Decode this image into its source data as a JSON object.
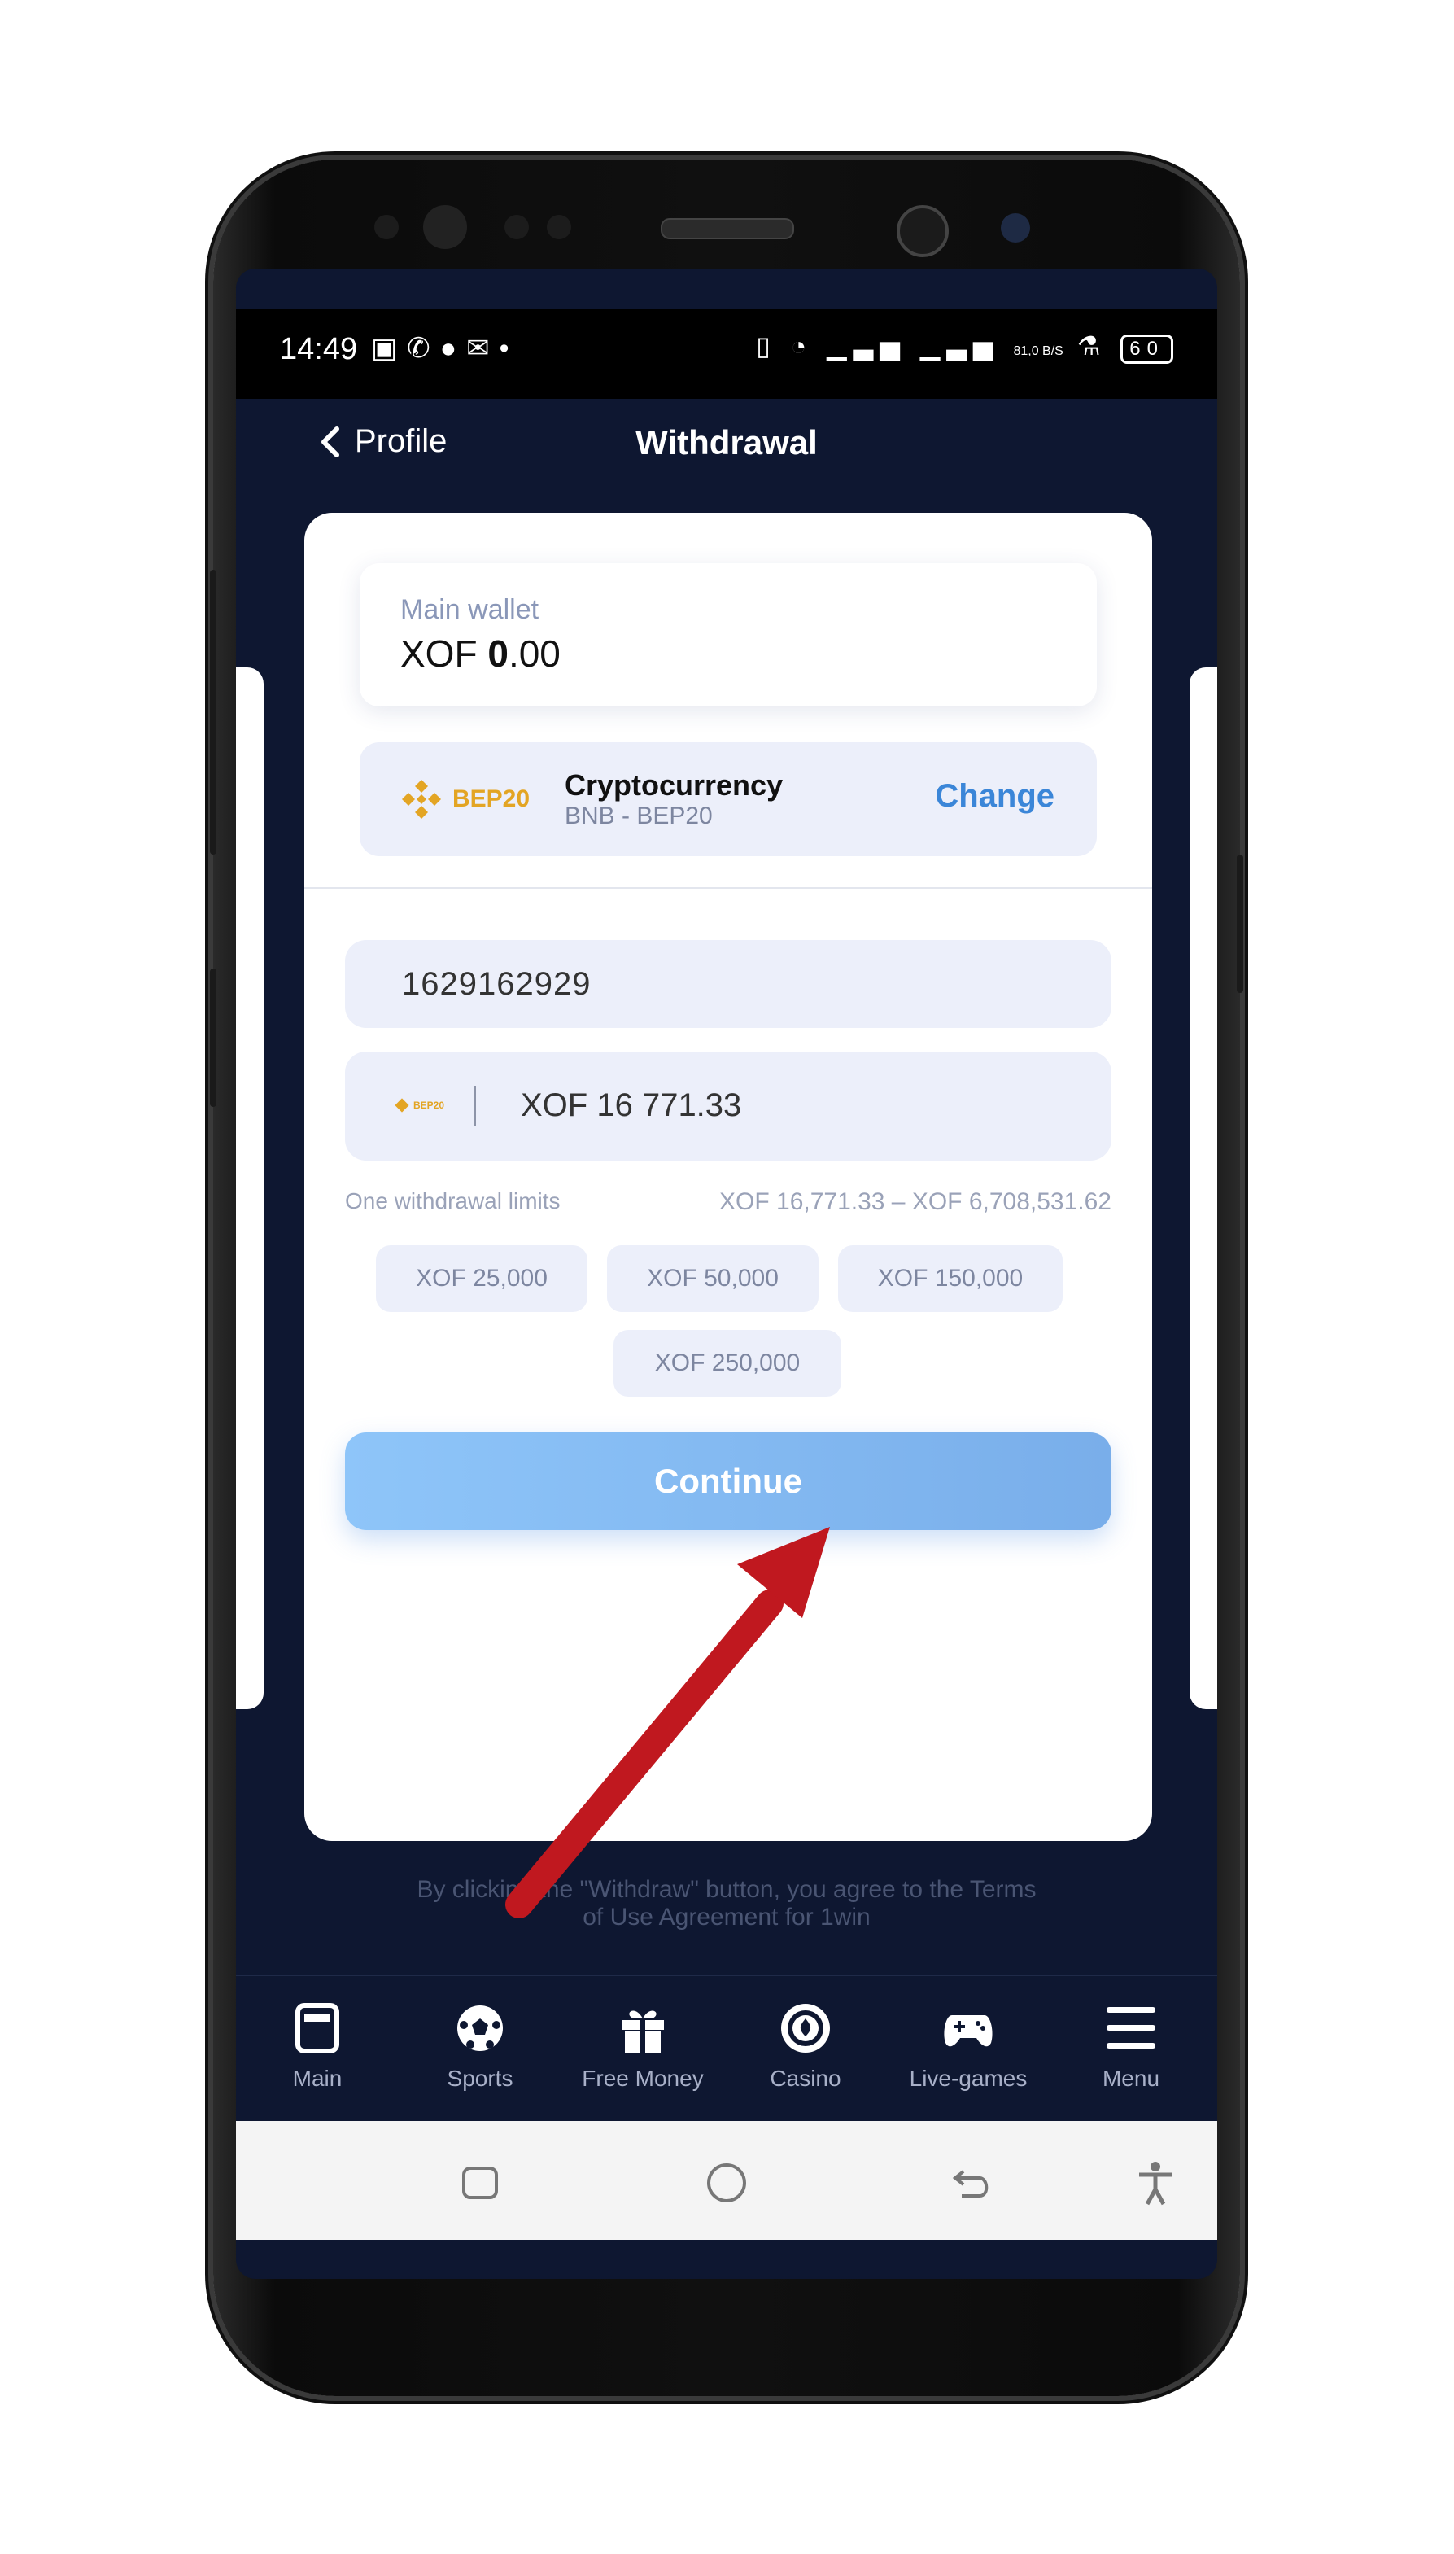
{
  "status_bar": {
    "time": "14:49",
    "battery": "60",
    "net_speed": "81,0 B/S"
  },
  "header": {
    "back_label": "Profile",
    "title": "Withdrawal"
  },
  "wallet": {
    "label": "Main wallet",
    "currency": "XOF",
    "amount_bold": "0",
    "amount_rest": ".00"
  },
  "method": {
    "logo_text": "BEP20",
    "name": "Cryptocurrency",
    "sub": "BNB - BEP20",
    "change_label": "Change"
  },
  "fields": {
    "account": "1629162929",
    "amount_logo": "BEP20",
    "amount": "XOF 16 771.33"
  },
  "limits": {
    "label": "One withdrawal limits",
    "range": "XOF 16,771.33  –  XOF 6,708,531.62"
  },
  "chips": [
    "XOF 25,000",
    "XOF 50,000",
    "XOF 150,000",
    "XOF 250,000"
  ],
  "continue_label": "Continue",
  "terms": {
    "line1": "By clicking the \"Withdraw\" button, you agree to the Terms",
    "line2": "of Use Agreement for 1win"
  },
  "nav": [
    {
      "label": "Main",
      "icon": "main-icon"
    },
    {
      "label": "Sports",
      "icon": "soccer-ball-icon"
    },
    {
      "label": "Free Money",
      "icon": "gift-icon"
    },
    {
      "label": "Casino",
      "icon": "casino-chip-icon"
    },
    {
      "label": "Live-games",
      "icon": "gamepad-icon"
    },
    {
      "label": "Menu",
      "icon": "hamburger-icon"
    }
  ],
  "colors": {
    "app_bg": "#0e1731",
    "accent": "#3b86d8",
    "button": "#8ec5f9",
    "arrow": "#c0181f",
    "bep20": "#e3a524"
  }
}
